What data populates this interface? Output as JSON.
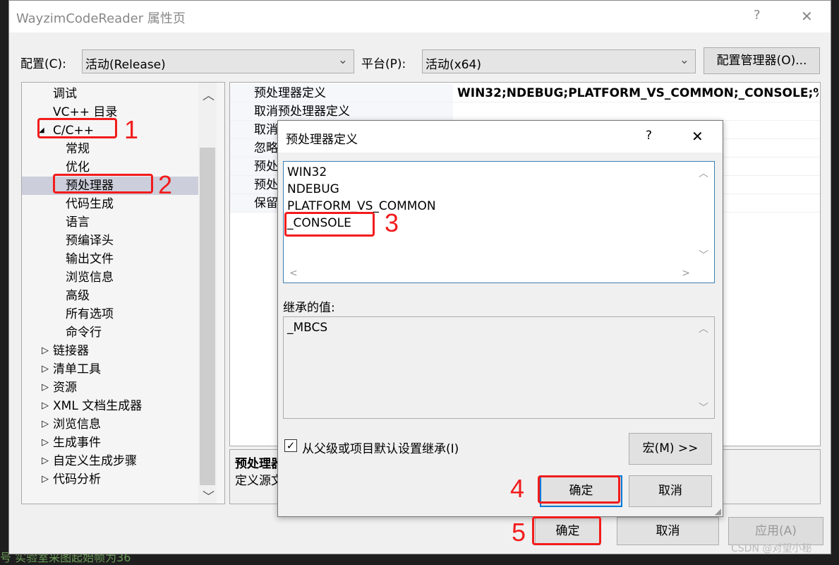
{
  "window": {
    "title": "WayzimCodeReader 属性页",
    "help": "?",
    "close": "✕"
  },
  "config": {
    "label": "配置(C):",
    "value": "活动(Release)",
    "platform_label": "平台(P):",
    "platform_value": "活动(x64)",
    "manager_button": "配置管理器(O)..."
  },
  "tree": {
    "items": [
      {
        "label": "调试",
        "level": 1,
        "expander": ""
      },
      {
        "label": "VC++ 目录",
        "level": 1,
        "expander": ""
      },
      {
        "label": "C/C++",
        "level": 1,
        "expander": "◢"
      },
      {
        "label": "常规",
        "level": 2,
        "expander": ""
      },
      {
        "label": "优化",
        "level": 2,
        "expander": ""
      },
      {
        "label": "预处理器",
        "level": 2,
        "expander": "",
        "selected": true
      },
      {
        "label": "代码生成",
        "level": 2,
        "expander": ""
      },
      {
        "label": "语言",
        "level": 2,
        "expander": ""
      },
      {
        "label": "预编译头",
        "level": 2,
        "expander": ""
      },
      {
        "label": "输出文件",
        "level": 2,
        "expander": ""
      },
      {
        "label": "浏览信息",
        "level": 2,
        "expander": ""
      },
      {
        "label": "高级",
        "level": 2,
        "expander": ""
      },
      {
        "label": "所有选项",
        "level": 2,
        "expander": ""
      },
      {
        "label": "命令行",
        "level": 2,
        "expander": ""
      },
      {
        "label": "链接器",
        "level": 1,
        "expander": "▷"
      },
      {
        "label": "清单工具",
        "level": 1,
        "expander": "▷"
      },
      {
        "label": "资源",
        "level": 1,
        "expander": "▷"
      },
      {
        "label": "XML 文档生成器",
        "level": 1,
        "expander": "▷"
      },
      {
        "label": "浏览信息",
        "level": 1,
        "expander": "▷"
      },
      {
        "label": "生成事件",
        "level": 1,
        "expander": "▷"
      },
      {
        "label": "自定义生成步骤",
        "level": 1,
        "expander": "▷"
      },
      {
        "label": "代码分析",
        "level": 1,
        "expander": "▷"
      }
    ]
  },
  "grid": {
    "rows": [
      {
        "name": "预处理器定义",
        "value": "WIN32;NDEBUG;PLATFORM_VS_COMMON;_CONSOLE;%("
      },
      {
        "name": "取消预处理器定义",
        "value": ""
      },
      {
        "name": "取消",
        "value": ""
      },
      {
        "name": "忽略",
        "value": ""
      },
      {
        "name": "预处",
        "value": ""
      },
      {
        "name": "预处",
        "value": ""
      },
      {
        "name": "保留",
        "value": ""
      }
    ]
  },
  "description": {
    "title": "预处理器",
    "text": "定义源文"
  },
  "footer": {
    "ok": "确定",
    "cancel": "取消",
    "apply": "应用(A)"
  },
  "dialog": {
    "title": "预处理器定义",
    "help": "?",
    "close": "✕",
    "values": [
      "WIN32",
      "NDEBUG",
      "PLATFORM_VS_COMMON",
      "_CONSOLE"
    ],
    "inherited_label": "继承的值:",
    "inherited": [
      "_MBCS"
    ],
    "inherit_checkbox": "从父级或项目默认设置继承(I)",
    "inherit_checked": true,
    "macro_button": "宏(M) >>",
    "ok": "确定",
    "cancel": "取消"
  },
  "annotations": [
    "1",
    "2",
    "3",
    "4",
    "5"
  ],
  "watermark": "CSDN @对望小秘",
  "background_code": "号    实验室采图起始帧为36"
}
